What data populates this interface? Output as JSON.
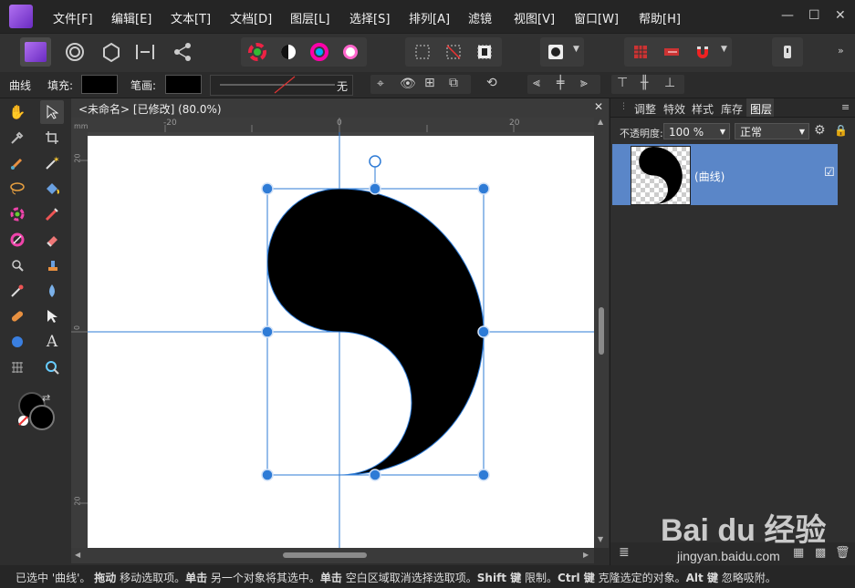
{
  "menubar": {
    "items": [
      "文件[F]",
      "编辑[E]",
      "文本[T]",
      "文档[D]",
      "图层[L]",
      "选择[S]",
      "排列[A]",
      "滤镜",
      "视图[V]",
      "窗口[W]",
      "帮助[H]"
    ],
    "minimize": "—",
    "maximize": "☐",
    "close": "✕"
  },
  "context": {
    "tool_name": "曲线",
    "fill_label": "填充:",
    "stroke_label": "笔画:",
    "stroke_style": "无"
  },
  "document": {
    "tab_title": "<未命名> [已修改] (80.0%)",
    "close": "✕",
    "ruler_unit": "mm",
    "ruler_h_ticks": [
      "-20",
      "0",
      "20"
    ],
    "ruler_v_ticks": [
      "20",
      "0",
      "20"
    ],
    "colors": {
      "selection": "#2e7bd6",
      "shape": "#000000"
    }
  },
  "panel": {
    "tabs": [
      "调整",
      "特效",
      "样式",
      "库存",
      "图层"
    ],
    "active_tab": "图层",
    "opacity_label": "不透明度:",
    "opacity_value": "100 %",
    "blend_mode": "正常",
    "layer_name": "(曲线)",
    "layer_checkbox": "☑",
    "colors": {
      "selected_layer": "#5a86c8"
    }
  },
  "status": {
    "parts": [
      {
        "text": "已选中 '曲线'。 ",
        "bold": false
      },
      {
        "text": "拖动",
        "bold": true
      },
      {
        "text": " 移动选取项。",
        "bold": false
      },
      {
        "text": "单击",
        "bold": true
      },
      {
        "text": " 另一个对象将其选中。",
        "bold": false
      },
      {
        "text": "单击",
        "bold": true
      },
      {
        "text": " 空白区域取消选择选取项。",
        "bold": false
      },
      {
        "text": "Shift 键",
        "bold": true
      },
      {
        "text": " 限制。",
        "bold": false
      },
      {
        "text": "Ctrl 键",
        "bold": true
      },
      {
        "text": " 克隆选定的对象。",
        "bold": false
      },
      {
        "text": "Alt 键",
        "bold": true
      },
      {
        "text": " 忽略吸附。",
        "bold": false
      }
    ]
  },
  "watermark": {
    "text": "Bai du 经验",
    "url": "jingyan.baidu.com"
  }
}
